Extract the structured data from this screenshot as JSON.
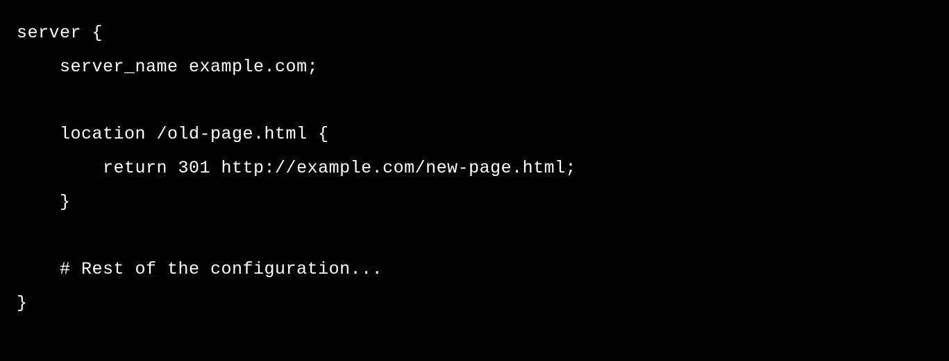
{
  "code": {
    "lines": [
      "server {",
      "    server_name example.com;",
      "",
      "    location /old-page.html {",
      "        return 301 http://example.com/new-page.html;",
      "    }",
      "",
      "    # Rest of the configuration...",
      "}"
    ]
  }
}
